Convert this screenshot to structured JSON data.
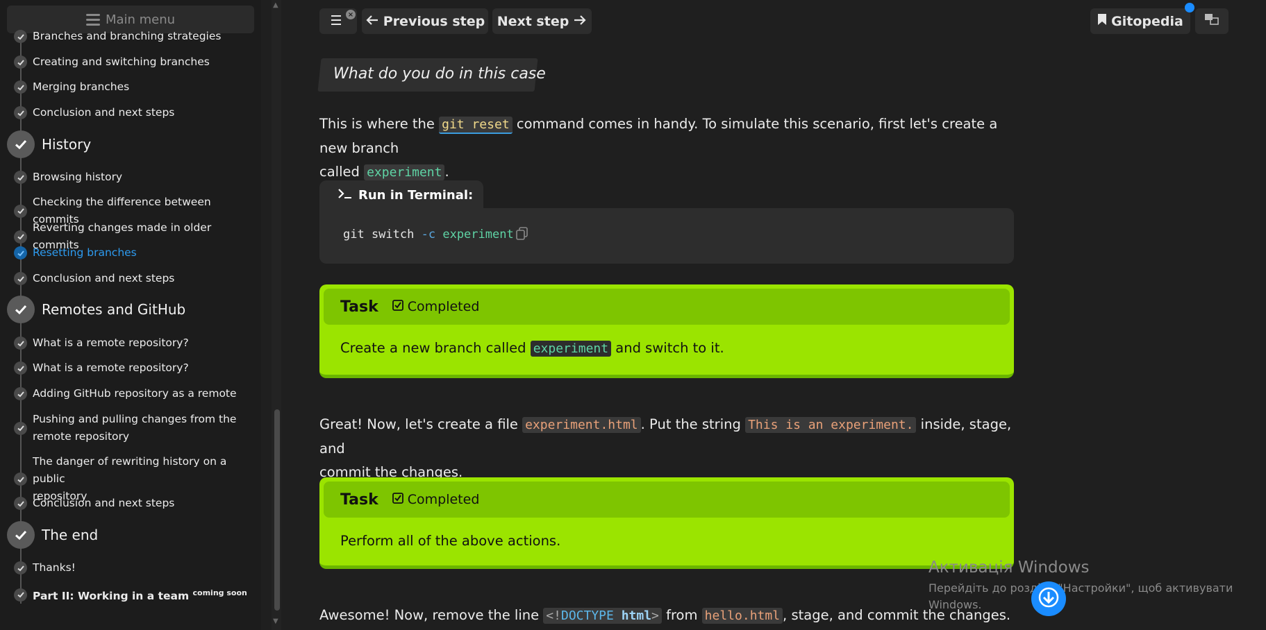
{
  "sidebar": {
    "main_menu_label": "Main menu",
    "items": [
      {
        "label": "Branches and branching strategies"
      },
      {
        "label": "Creating and switching branches"
      },
      {
        "label": "Merging branches"
      },
      {
        "label": "Conclusion and next steps"
      },
      {
        "section": "History"
      },
      {
        "label": "Browsing history"
      },
      {
        "label": "Checking the difference between commits"
      },
      {
        "label": "Reverting changes made in older commits"
      },
      {
        "label": "Resetting branches",
        "active": true
      },
      {
        "label": "Conclusion and next steps"
      },
      {
        "section": "Remotes and GitHub"
      },
      {
        "label": "What is a remote repository?"
      },
      {
        "label": "What is a remote repository?"
      },
      {
        "label": "Adding GitHub repository as a remote"
      },
      {
        "label_line1": "Pushing and pulling changes from the",
        "label_line2": "remote repository"
      },
      {
        "label_line1": "The danger of rewriting history on a public",
        "label_line2": "repository"
      },
      {
        "label": "Conclusion and next steps"
      },
      {
        "section": "The end"
      },
      {
        "label": "Thanks!"
      },
      {
        "label": "Part II: Working in a team",
        "sup": "coming soon"
      }
    ]
  },
  "toolbar": {
    "prev_label": "Previous step",
    "next_label": "Next step",
    "gitopedia_label": "Gitopedia",
    "badge_x": "×"
  },
  "content": {
    "heading": "What do you do in this case",
    "para1": {
      "t1": "This is where the ",
      "code1": "git reset",
      "t2": " command comes in handy. To simulate this scenario, first let's create a new branch",
      "t3": "called ",
      "code2": "experiment",
      "t4": "."
    },
    "terminal": {
      "tab_label": "Run in Terminal:",
      "cmd_main": "git switch",
      "cmd_flag": "-c",
      "cmd_arg": "experiment"
    },
    "task1": {
      "title": "Task",
      "status": "Completed",
      "t1": "Create a new branch called ",
      "code": "experiment",
      "t2": " and switch to it."
    },
    "para2": {
      "t1": "Great! Now, let's create a file ",
      "code1": "experiment.html",
      "t2": ". Put the string ",
      "code2": "This is an experiment.",
      "t3": " inside, stage, and",
      "t4": "commit the changes."
    },
    "task2": {
      "title": "Task",
      "status": "Completed",
      "body": "Perform all of the above actions."
    },
    "para3": {
      "t1": "Awesome! Now, remove the line ",
      "code1a": "<!",
      "code1b": "DOCTYPE",
      "code1c": "html",
      "code1d": ">",
      "t2": " from ",
      "code2": "hello.html",
      "t3": ", stage, and commit the changes."
    }
  },
  "watermark": {
    "title": "Активація Windows",
    "line1": "Перейдіть до розділу \"Настройки\", щоб активувати",
    "line2": "Windows."
  },
  "colors": {
    "accent_blue": "#1a8cff",
    "task_green": "#9be400",
    "active_link": "#2d9bf0"
  }
}
